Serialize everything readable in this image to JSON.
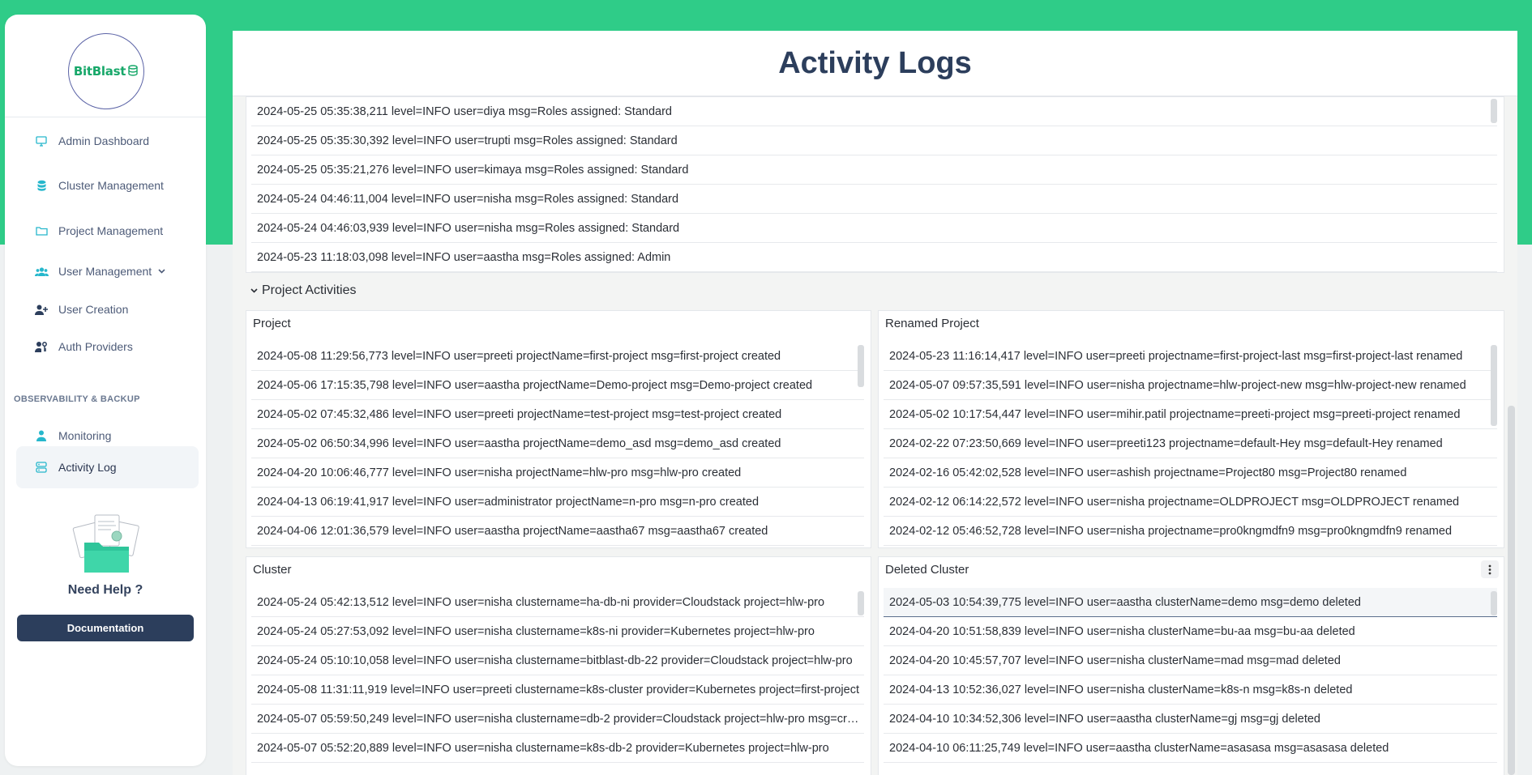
{
  "brand": {
    "name": "BitBlast",
    "icon": "database-icon"
  },
  "sidebar": {
    "items": [
      {
        "label": "Admin Dashboard",
        "icon": "monitor-icon"
      },
      {
        "label": "Cluster Management",
        "icon": "database-icon"
      },
      {
        "label": "Project Management",
        "icon": "folder-icon"
      },
      {
        "label": "User Management",
        "icon": "users-icon"
      },
      {
        "label": "User Creation",
        "icon": "user-plus-icon"
      },
      {
        "label": "Auth Providers",
        "icon": "user-key-icon"
      },
      {
        "label": "Monitoring",
        "icon": "user-icon"
      },
      {
        "label": "Activity Log",
        "icon": "server-icon"
      }
    ],
    "section_label": "OBSERVABILITY & BACKUP",
    "help_title": "Need Help ?",
    "doc_button": "Documentation"
  },
  "page": {
    "title": "Activity Logs"
  },
  "role_logs": [
    "2024-05-25 05:35:38,211 level=INFO user=diya msg=Roles assigned: Standard",
    "2024-05-25 05:35:30,392 level=INFO user=trupti msg=Roles assigned: Standard",
    "2024-05-25 05:35:21,276 level=INFO user=kimaya msg=Roles assigned: Standard",
    "2024-05-24 04:46:11,004 level=INFO user=nisha msg=Roles assigned: Standard",
    "2024-05-24 04:46:03,939 level=INFO user=nisha msg=Roles assigned: Standard",
    "2024-05-23 11:18:03,098 level=INFO user=aastha msg=Roles assigned: Admin"
  ],
  "project_section": {
    "label": "Project Activities"
  },
  "panels": {
    "project": {
      "title": "Project",
      "logs": [
        "2024-05-08 11:29:56,773 level=INFO user=preeti projectName=first-project msg=first-project created",
        "2024-05-06 17:15:35,798 level=INFO user=aastha projectName=Demo-project msg=Demo-project created",
        "2024-05-02 07:45:32,486 level=INFO user=preeti projectName=test-project msg=test-project created",
        "2024-05-02 06:50:34,996 level=INFO user=aastha projectName=demo_asd msg=demo_asd created",
        "2024-04-20 10:06:46,777 level=INFO user=nisha projectName=hlw-pro msg=hlw-pro created",
        "2024-04-13 06:19:41,917 level=INFO user=administrator projectName=n-pro msg=n-pro created",
        "2024-04-06 12:01:36,579 level=INFO user=aastha projectName=aastha67 msg=aastha67 created"
      ]
    },
    "renamed": {
      "title": "Renamed Project",
      "logs": [
        "2024-05-23 11:16:14,417 level=INFO user=preeti projectname=first-project-last msg=first-project-last renamed",
        "2024-05-07 09:57:35,591 level=INFO user=nisha projectname=hlw-project-new msg=hlw-project-new renamed",
        "2024-05-02 10:17:54,447 level=INFO user=mihir.patil projectname=preeti-project msg=preeti-project renamed",
        "2024-02-22 07:23:50,669 level=INFO user=preeti123 projectname=default-Hey msg=default-Hey renamed",
        "2024-02-16 05:42:02,528 level=INFO user=ashish projectname=Project80 msg=Project80 renamed",
        "2024-02-12 06:14:22,572 level=INFO user=nisha projectname=OLDPROJECT msg=OLDPROJECT renamed",
        "2024-02-12 05:46:52,728 level=INFO user=nisha projectname=pro0kngmdfn9 msg=pro0kngmdfn9 renamed"
      ]
    },
    "cluster": {
      "title": "Cluster",
      "logs": [
        "2024-05-24 05:42:13,512 level=INFO user=nisha clustername=ha-db-ni provider=Cloudstack project=hlw-pro",
        "2024-05-24 05:27:53,092 level=INFO user=nisha clustername=k8s-ni provider=Kubernetes project=hlw-pro",
        "2024-05-24 05:10:10,058 level=INFO user=nisha clustername=bitblast-db-22 provider=Cloudstack project=hlw-pro",
        "2024-05-08 11:31:11,919 level=INFO user=preeti clustername=k8s-cluster provider=Kubernetes project=first-project",
        "2024-05-07 05:59:50,249 level=INFO user=nisha clustername=db-2 provider=Cloudstack project=hlw-pro msg=created",
        "2024-05-07 05:52:20,889 level=INFO user=nisha clustername=k8s-db-2 provider=Kubernetes project=hlw-pro"
      ]
    },
    "deleted": {
      "title": "Deleted Cluster",
      "logs": [
        "2024-05-03 10:54:39,775 level=INFO user=aastha clusterName=demo msg=demo deleted",
        "2024-04-20 10:51:58,839 level=INFO user=nisha clusterName=bu-aa msg=bu-aa deleted",
        "2024-04-20 10:45:57,707 level=INFO user=nisha clusterName=mad msg=mad deleted",
        "2024-04-13 10:52:36,027 level=INFO user=nisha clusterName=k8s-n msg=k8s-n deleted",
        "2024-04-10 10:34:52,306 level=INFO user=aastha clusterName=gj msg=gj deleted",
        "2024-04-10 06:11:25,749 level=INFO user=aastha clusterName=asasasa msg=asasasa deleted"
      ]
    }
  }
}
